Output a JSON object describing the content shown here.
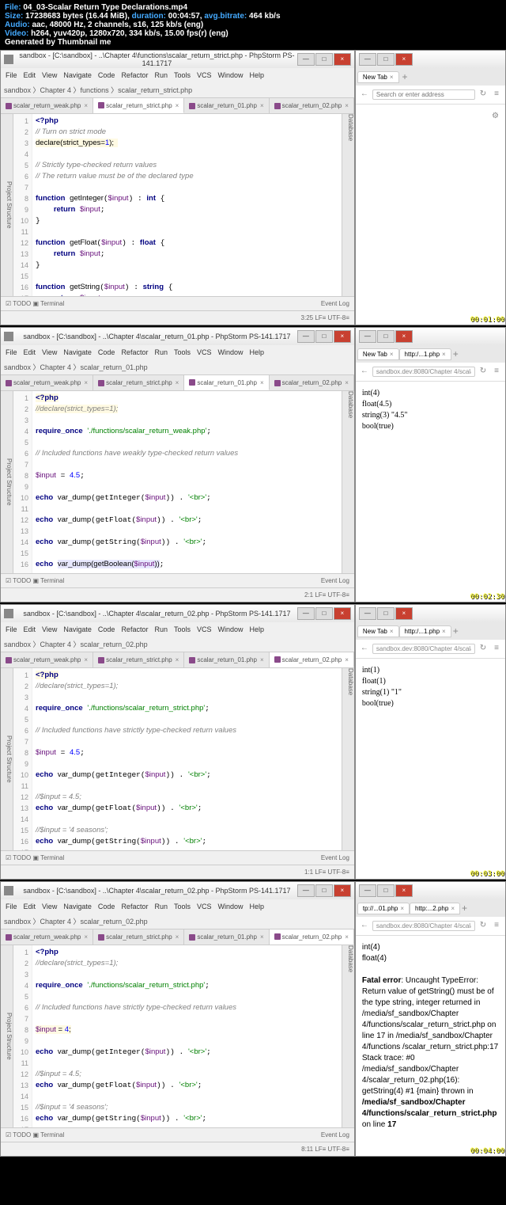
{
  "header": {
    "file_label": "File:",
    "file": "04_03-Scalar Return Type Declarations.mp4",
    "size_label": "Size:",
    "size": "17238683 bytes (16.44 MiB),",
    "duration_label": "duration:",
    "duration": "00:04:57,",
    "bitrate_label": "avg.bitrate:",
    "bitrate": "464 kb/s",
    "audio_label": "Audio:",
    "audio": "aac, 48000 Hz, 2 channels, s16, 125 kb/s (eng)",
    "video_label": "Video:",
    "video": "h264, yuv420p, 1280x720, 334 kb/s, 15.00 fps(r) (eng)",
    "gen": "Generated by Thumbnail me"
  },
  "menu": [
    "File",
    "Edit",
    "View",
    "Navigate",
    "Code",
    "Refactor",
    "Run",
    "Tools",
    "VCS",
    "Window",
    "Help"
  ],
  "frame1": {
    "title": "sandbox - [C:\\sandbox] - ..\\Chapter 4\\functions\\scalar_return_strict.php - PhpStorm PS-141.1717",
    "breadcrumb": "sandbox 〉Chapter 4 〉functions 〉scalar_return_strict.php",
    "tabs": [
      {
        "name": "scalar_return_weak.php",
        "active": false
      },
      {
        "name": "scalar_return_strict.php",
        "active": true
      },
      {
        "name": "scalar_return_01.php",
        "active": false
      },
      {
        "name": "scalar_return_02.php",
        "active": false
      }
    ],
    "status": "3:25  LF≡  UTF-8≡",
    "browser_tabs": [
      {
        "name": "New Tab"
      }
    ],
    "browser_addr": "Search or enter address",
    "timestamp": "00:01:00"
  },
  "frame2": {
    "title": "sandbox - [C:\\sandbox] - ..\\Chapter 4\\scalar_return_01.php - PhpStorm PS-141.1717",
    "breadcrumb": "sandbox 〉Chapter 4 〉scalar_return_01.php",
    "tabs": [
      {
        "name": "scalar_return_weak.php",
        "active": false
      },
      {
        "name": "scalar_return_strict.php",
        "active": false
      },
      {
        "name": "scalar_return_01.php",
        "active": true
      },
      {
        "name": "scalar_return_02.php",
        "active": false
      }
    ],
    "status": "2:1  LF≡  UTF-8≡",
    "browser_tabs": [
      {
        "name": "New Tab"
      },
      {
        "name": "http:/...1.php"
      }
    ],
    "browser_addr": "sandbox.dev:8080/Chapter 4/scalar_return",
    "browser_content": "int(4)\nfloat(4.5)\nstring(3) \"4.5\"\nbool(true)",
    "timestamp": "00:02:30"
  },
  "frame3": {
    "title": "sandbox - [C:\\sandbox] - ..\\Chapter 4\\scalar_return_02.php - PhpStorm PS-141.1717",
    "breadcrumb": "sandbox 〉Chapter 4 〉scalar_return_02.php",
    "tabs": [
      {
        "name": "scalar_return_weak.php",
        "active": false
      },
      {
        "name": "scalar_return_strict.php",
        "active": false
      },
      {
        "name": "scalar_return_01.php",
        "active": false
      },
      {
        "name": "scalar_return_02.php",
        "active": true
      }
    ],
    "status": "1:1  LF≡  UTF-8≡",
    "browser_tabs": [
      {
        "name": "New Tab"
      },
      {
        "name": "http:/...1.php"
      }
    ],
    "browser_addr": "sandbox.dev:8080/Chapter 4/scalar_return",
    "browser_content": "int(1)\nfloat(1)\nstring(1) \"1\"\nbool(true)",
    "timestamp": "00:03:00"
  },
  "frame4": {
    "title": "sandbox - [C:\\sandbox] - ..\\Chapter 4\\scalar_return_02.php - PhpStorm PS-141.1717",
    "breadcrumb": "sandbox 〉Chapter 4 〉scalar_return_02.php",
    "tabs": [
      {
        "name": "scalar_return_weak.php",
        "active": false
      },
      {
        "name": "scalar_return_strict.php",
        "active": false
      },
      {
        "name": "scalar_return_01.php",
        "active": false
      },
      {
        "name": "scalar_return_02.php",
        "active": true
      }
    ],
    "status": "8:11  LF≡  UTF-8≡",
    "browser_tabs": [
      {
        "name": "tp://...01.php"
      },
      {
        "name": "http:...2.php"
      }
    ],
    "browser_addr": "sandbox.dev:8080/Chapter 4/scalar_return",
    "browser_content_pre": "int(4)\nfloat(4)\n",
    "browser_error": "Fatal error",
    "browser_error_text": ": Uncaught TypeError: Return value of getString() must be of the type string, integer returned in /media/sf_sandbox/Chapter 4/functions/scalar_return_strict.php on line 17 in /media/sf_sandbox/Chapter 4/functions /scalar_return_strict.php:17 Stack trace: #0 /media/sf_sandbox/Chapter 4/scalar_return_02.php(16): getString(4) #1 {main} thrown in ",
    "browser_error_bold": "/media/sf_sandbox/Chapter 4/functions/scalar_return_strict.php",
    "browser_error_end": " on line ",
    "browser_error_line": "17",
    "timestamp": "00:04:00"
  },
  "bottom": {
    "todo": "TODO",
    "terminal": "Terminal",
    "eventlog": "Event Log"
  }
}
